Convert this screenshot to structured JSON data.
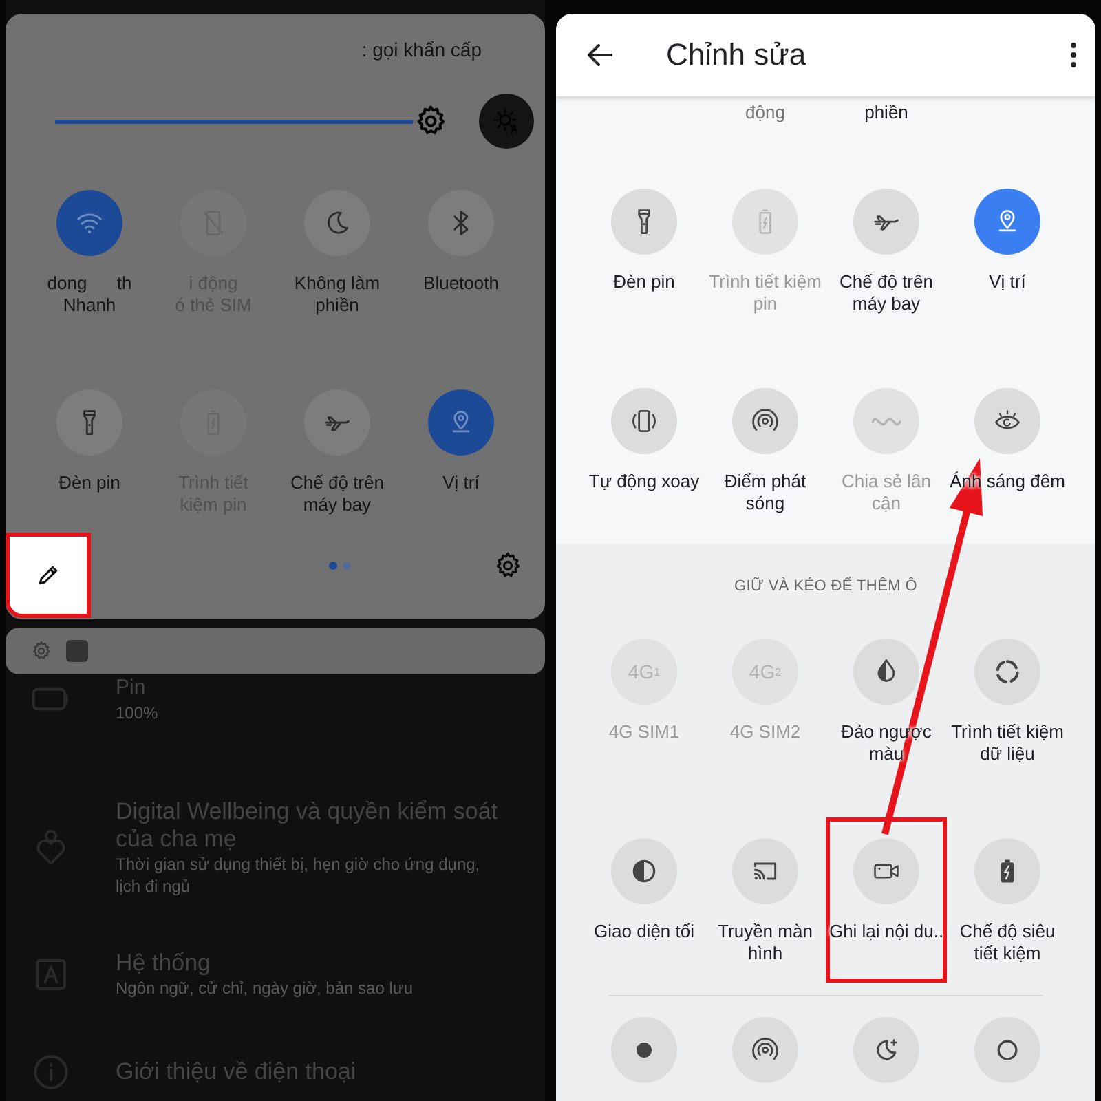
{
  "quick_panel": {
    "emergency_text": ": gọi khẩn cấp",
    "brightness": {
      "level": 0.97
    },
    "tiles": [
      {
        "label": "dong      th\nNhanh",
        "on": true,
        "disabled": false
      },
      {
        "label": "i động\nó thẻ SIM",
        "disabled": true
      },
      {
        "label": "Không làm\nphiền",
        "on": false,
        "disabled": false
      },
      {
        "label": "Bluetooth",
        "on": false,
        "disabled": false
      },
      {
        "label": "Đèn pin",
        "on": false,
        "disabled": false
      },
      {
        "label": "Trình tiết\nkiệm pin",
        "disabled": true
      },
      {
        "label": "Chế độ trên\nmáy bay",
        "on": false,
        "disabled": false
      },
      {
        "label": "Vị trí",
        "on": true,
        "disabled": false
      }
    ],
    "pages": [
      {
        "selected": true
      },
      {
        "selected": false
      }
    ],
    "edit_button": {
      "highlighted": true
    }
  },
  "settings_list": [
    {
      "title": "Pin",
      "subtitle": "100%"
    },
    {
      "title": "Digital Wellbeing và quyền kiểm soát\ncủa cha mẹ",
      "subtitle": "Thời gian sử dụng thiết bị, hẹn giờ cho ứng dụng,\nlịch đi ngủ"
    },
    {
      "title": "Hệ thống",
      "subtitle": "Ngôn ngữ, cử chỉ, ngày giờ, bản sao lưu"
    },
    {
      "title": "Giới thiệu về điện thoại"
    }
  ],
  "editor": {
    "title": "Chỉnh sửa",
    "cut_labels": [
      "động",
      "phiền"
    ],
    "tiles": [
      {
        "label": "Đèn pin",
        "on": false,
        "disabled": false
      },
      {
        "label": "Trình tiết kiệm\npin",
        "disabled": true
      },
      {
        "label": "Chế độ trên\nmáy bay",
        "on": false,
        "disabled": false
      },
      {
        "label": "Vị trí",
        "on": true,
        "disabled": false
      },
      {
        "label": "Tự động xoay",
        "on": false,
        "disabled": false
      },
      {
        "label": "Điểm phát\nsóng",
        "on": false,
        "disabled": false
      },
      {
        "label": "Chia sẻ lân\ncận",
        "disabled": true
      },
      {
        "label": "Ánh sáng đêm",
        "on": false,
        "disabled": false
      }
    ],
    "section_title": "GIỮ VÀ KÉO ĐỂ THÊM Ô",
    "available_tiles": [
      {
        "label": "4G SIM1",
        "icon_text": "4G$^{1}$",
        "disabled": true,
        "highlighted": false
      },
      {
        "label": "4G SIM2",
        "icon_text": "4G$^{2}$",
        "disabled": true,
        "highlighted": false
      },
      {
        "label": "Đảo ngược\nmàu",
        "disabled": false,
        "highlighted": false
      },
      {
        "label": "Trình tiết kiệm\ndữ liệu",
        "disabled": false,
        "highlighted": false
      },
      {
        "label": "Giao diện tối",
        "disabled": false,
        "highlighted": false
      },
      {
        "label": "Truyền màn\nhình",
        "disabled": false,
        "highlighted": false
      },
      {
        "label": "Ghi lại nội du..",
        "disabled": false,
        "highlighted": true
      },
      {
        "label": "Chế độ siêu\ntiết kiệm",
        "disabled": false,
        "highlighted": false
      }
    ]
  }
}
